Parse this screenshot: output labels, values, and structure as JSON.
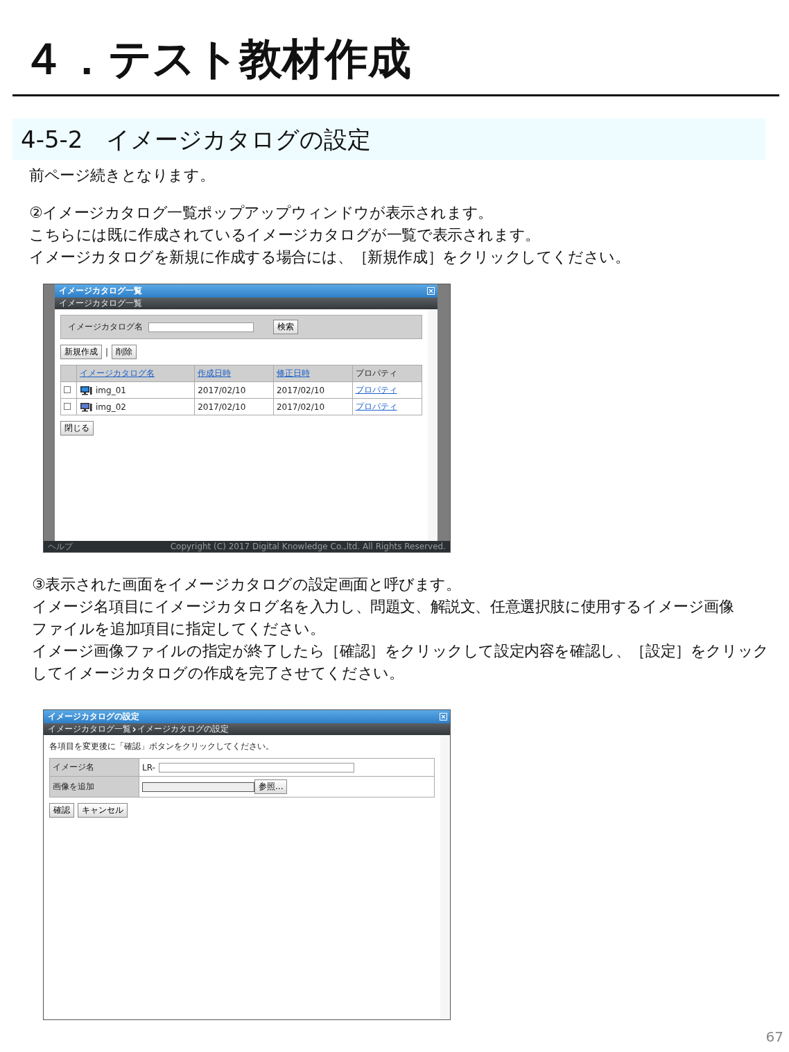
{
  "title": "４．テスト教材作成",
  "section": "4-5-2　イメージカタログの設定",
  "intro": "前ページ続きとなります。",
  "step2": [
    "②イメージカタログ一覧ポップアップウィンドウが表示されます。",
    "こちらには既に作成されているイメージカタログが一覧で表示されます。",
    "イメージカタログを新規に作成する場合には、［新規作成］をクリックしてください。"
  ],
  "list_window": {
    "title": "イメージカタログ一覧",
    "breadcrumb": "イメージカタログ一覧",
    "search_label": "イメージカタログ名",
    "search_button": "検索",
    "new_button": "新規作成",
    "separator": "|",
    "delete_button": "削除",
    "columns": [
      "イメージカタログ名",
      "作成日時",
      "修正日時",
      "プロパティ"
    ],
    "rows": [
      {
        "checked": false,
        "name": "img_01",
        "created": "2017/02/10",
        "modified": "2017/02/10",
        "link": "プロパティ"
      },
      {
        "checked": false,
        "name": "img_02",
        "created": "2017/02/10",
        "modified": "2017/02/10",
        "link": "プロパティ"
      }
    ],
    "close_button": "閉じる",
    "footer_left": "ヘルプ",
    "footer_right": "Copyright (C) 2017 Digital Knowledge Co.,ltd. All Rights Reserved."
  },
  "step3": [
    "③表示された画面をイメージカタログの設定画面と呼びます。",
    "イメージ名項目にイメージカタログ名を入力し、問題文、解説文、任意選択肢に使用するイメージ画像",
    "ファイルを追加項目に指定してください。",
    "イメージ画像ファイルの指定が終了したら［確認］をクリックして設定内容を確認し、［設定］をクリック",
    "してイメージカタログの作成を完了させてください。"
  ],
  "settings_window": {
    "title": "イメージカタログの設定",
    "breadcrumb": [
      "イメージカタログ一覧",
      "イメージカタログの設定"
    ],
    "instruction": "各項目を変更後に「確認」ボタンをクリックしてください。",
    "name_label": "イメージ名",
    "prefix": "LR-",
    "add_label": "画像を追加",
    "browse_button": "参照...",
    "confirm_button": "確認",
    "cancel_button": "キャンセル"
  },
  "page_number": "67"
}
